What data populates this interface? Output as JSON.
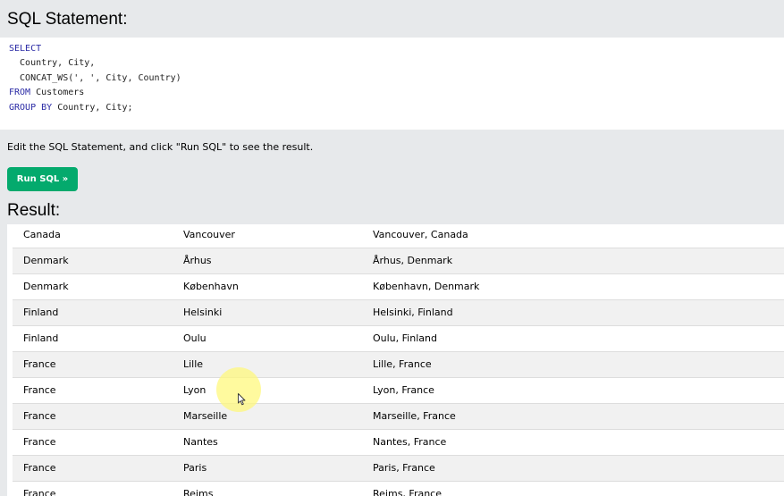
{
  "sql_heading": "SQL Statement:",
  "code": {
    "lines": [
      {
        "keyword": "SELECT",
        "text": ""
      },
      {
        "keyword": "",
        "text": "  Country, City,"
      },
      {
        "keyword": "",
        "text": "  CONCAT_WS(', ', City, Country)"
      },
      {
        "keyword": "FROM",
        "text": " Customers"
      },
      {
        "keyword": "GROUP BY",
        "text": " Country, City;"
      }
    ]
  },
  "instructions": "Edit the SQL Statement, and click \"Run SQL\" to see the result.",
  "run_button_label": "Run SQL »",
  "result_heading": "Result:",
  "results": {
    "rows": [
      {
        "country": "Canada",
        "city": "Vancouver",
        "concat": "Vancouver, Canada"
      },
      {
        "country": "Denmark",
        "city": "Århus",
        "concat": "Århus, Denmark"
      },
      {
        "country": "Denmark",
        "city": "København",
        "concat": "København, Denmark"
      },
      {
        "country": "Finland",
        "city": "Helsinki",
        "concat": "Helsinki, Finland"
      },
      {
        "country": "Finland",
        "city": "Oulu",
        "concat": "Oulu, Finland"
      },
      {
        "country": "France",
        "city": "Lille",
        "concat": "Lille, France"
      },
      {
        "country": "France",
        "city": "Lyon",
        "concat": "Lyon, France"
      },
      {
        "country": "France",
        "city": "Marseille",
        "concat": "Marseille, France"
      },
      {
        "country": "France",
        "city": "Nantes",
        "concat": "Nantes, France"
      },
      {
        "country": "France",
        "city": "Paris",
        "concat": "Paris, France"
      },
      {
        "country": "France",
        "city": "Reims",
        "concat": "Reims, France"
      }
    ]
  },
  "colors": {
    "run_button": "#04aa6d",
    "page_background": "#e7e9eb",
    "keyword": "#2a2aa5"
  }
}
